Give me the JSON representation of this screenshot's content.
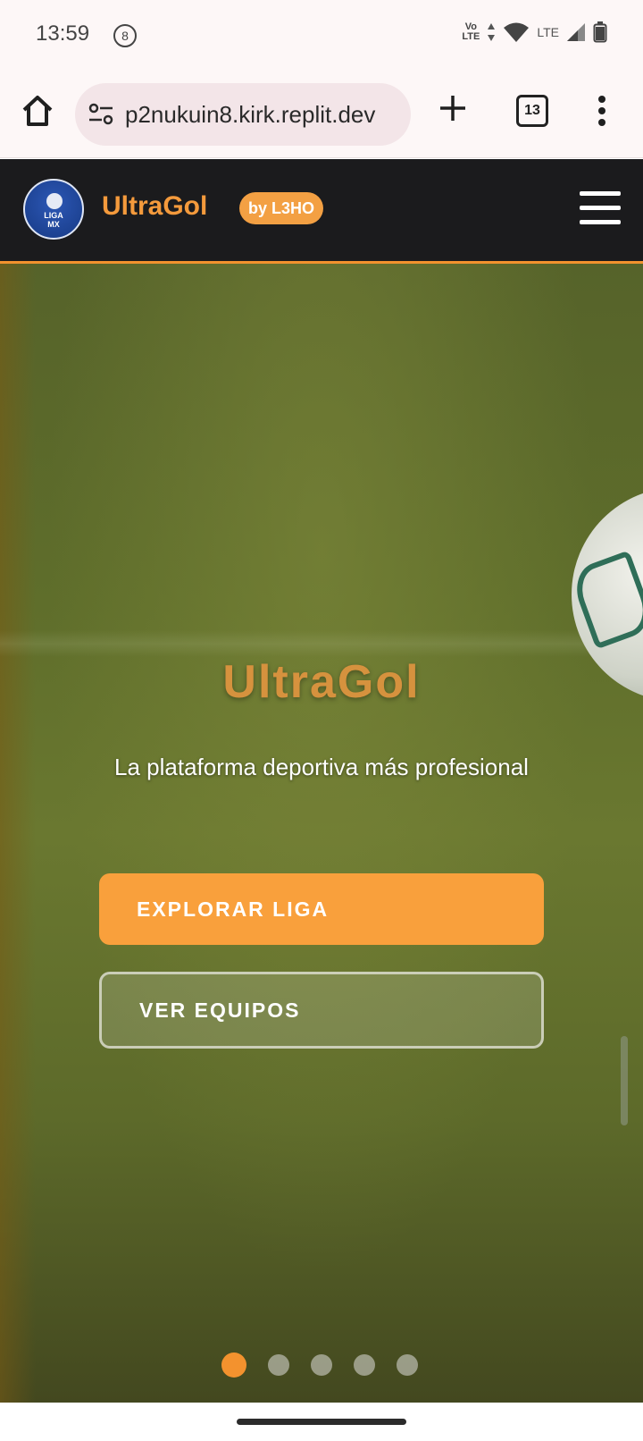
{
  "status_bar": {
    "time": "13:59",
    "notification_badge": "8",
    "volte_top": "Vo",
    "volte_bottom": "LTE",
    "network_label": "LTE",
    "icons": [
      "data-arrows-icon",
      "wifi-icon",
      "signal-icon",
      "battery-icon"
    ]
  },
  "browser": {
    "url": "p2nukuin8.kirk.replit.dev",
    "tab_count": "13",
    "icons": [
      "home-icon",
      "site-info-icon",
      "new-tab-icon",
      "tabs-icon",
      "more-menu-icon"
    ]
  },
  "site": {
    "logo_text_line1": "LIGA",
    "logo_text_line2": "MX",
    "brand": "UltraGol",
    "badge": "by L3HO",
    "accent_color": "#f49a3c",
    "header_bg": "#1b1b1d"
  },
  "hero": {
    "title": "UltraGol",
    "subtitle": "La plataforma deportiva más profesional",
    "primary_button": "EXPLORAR LIGA",
    "secondary_button": "VER EQUIPOS",
    "slide_count": 5,
    "active_slide": 1
  }
}
